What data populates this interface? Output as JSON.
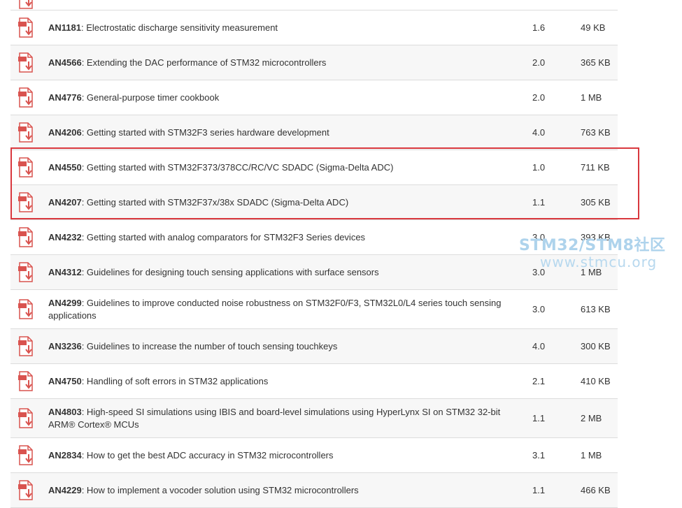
{
  "rows": [
    {
      "code": "",
      "title": "",
      "version": "",
      "size": ""
    },
    {
      "code": "AN1181",
      "title": ": Electrostatic discharge sensitivity measurement",
      "version": "1.6",
      "size": "49 KB"
    },
    {
      "code": "AN4566",
      "title": ": Extending the DAC performance of STM32 microcontrollers",
      "version": "2.0",
      "size": "365 KB"
    },
    {
      "code": "AN4776",
      "title": ": General-purpose timer cookbook",
      "version": "2.0",
      "size": "1 MB"
    },
    {
      "code": "AN4206",
      "title": ": Getting started with STM32F3 series hardware development",
      "version": "4.0",
      "size": "763 KB"
    },
    {
      "code": "AN4550",
      "title": ": Getting started with STM32F373/378CC/RC/VC SDADC (Sigma-Delta ADC)",
      "version": "1.0",
      "size": "711 KB"
    },
    {
      "code": "AN4207",
      "title": ": Getting started with STM32F37x/38x SDADC (Sigma-Delta ADC)",
      "version": "1.1",
      "size": "305 KB"
    },
    {
      "code": "AN4232",
      "title": ": Getting started with analog comparators for STM32F3 Series devices",
      "version": "3.0",
      "size": "393 KB"
    },
    {
      "code": "AN4312",
      "title": ": Guidelines for designing touch sensing applications with surface sensors",
      "version": "3.0",
      "size": "1 MB"
    },
    {
      "code": "AN4299",
      "title": ": Guidelines to improve conducted noise robustness on STM32F0/F3, STM32L0/L4 series touch sensing applications",
      "version": "3.0",
      "size": "613 KB"
    },
    {
      "code": "AN3236",
      "title": ": Guidelines to increase the number of touch sensing touchkeys",
      "version": "4.0",
      "size": "300 KB"
    },
    {
      "code": "AN4750",
      "title": ": Handling of soft errors in STM32 applications",
      "version": "2.1",
      "size": "410 KB"
    },
    {
      "code": "AN4803",
      "title": ": High-speed SI simulations using IBIS and board-level simulations using HyperLynx SI on STM32 32-bit ARM® Cortex® MCUs",
      "version": "1.1",
      "size": "2 MB"
    },
    {
      "code": "AN2834",
      "title": ": How to get the best ADC accuracy in STM32 microcontrollers",
      "version": "3.1",
      "size": "1 MB"
    },
    {
      "code": "AN4229",
      "title": ": How to implement a vocoder solution using STM32 microcontrollers",
      "version": "1.1",
      "size": "466 KB"
    }
  ],
  "icon": "pdf-download-icon",
  "colors": {
    "accent_red": "#d9383e",
    "icon_red": "#d9534f",
    "watermark_blue": "#aed3ec"
  },
  "watermark": {
    "line1": "STM32/STM8社区",
    "line2": "www.stmcu.org"
  }
}
